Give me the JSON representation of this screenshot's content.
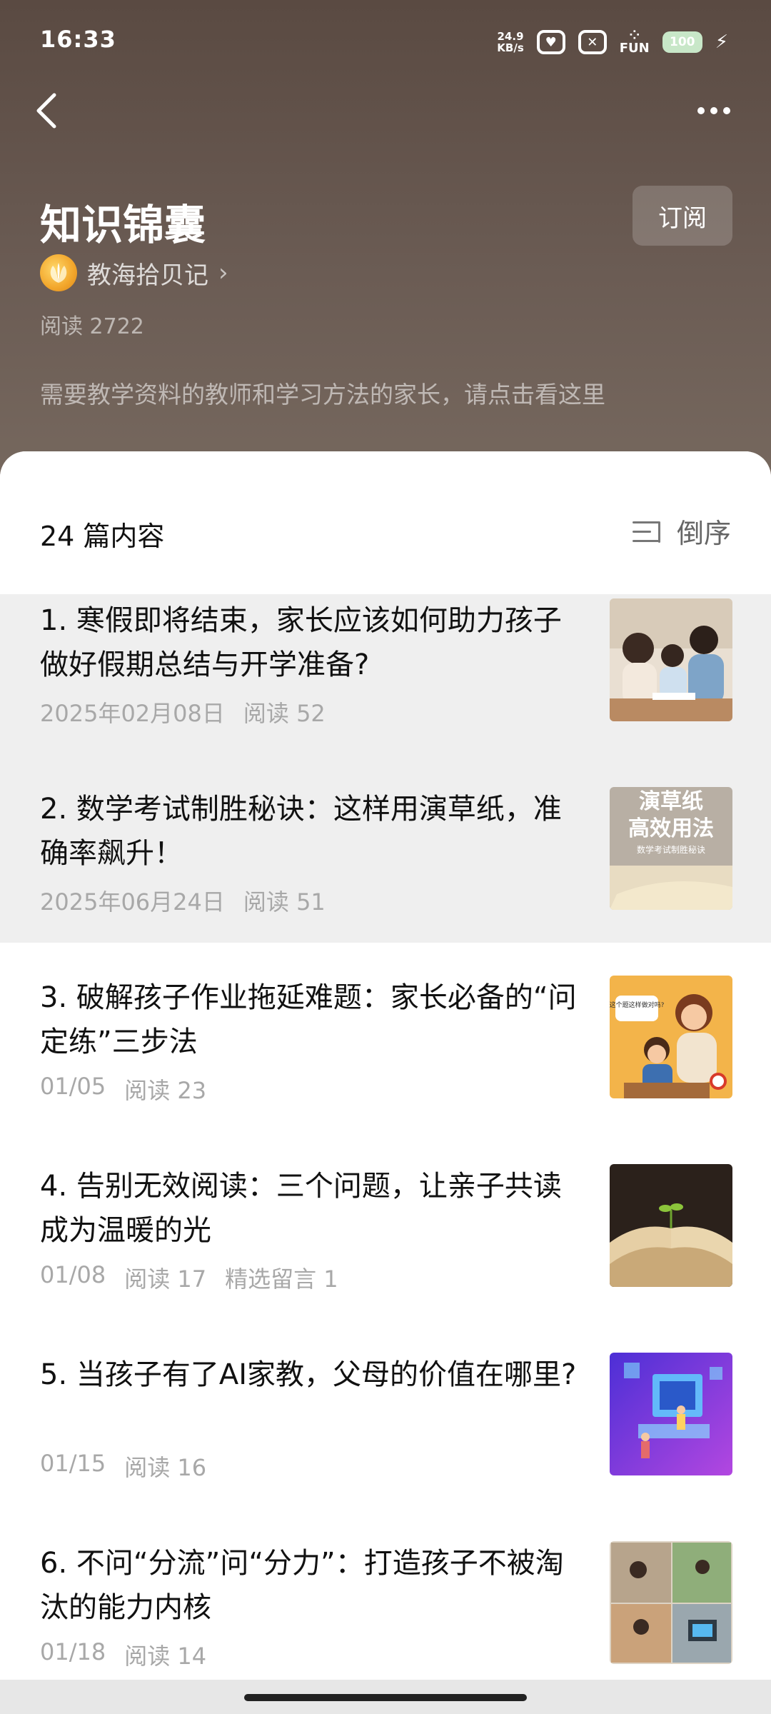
{
  "status": {
    "time": "16:33",
    "net_speed_value": "24.9",
    "net_speed_unit": "KB/s",
    "fun_label": "FUN",
    "battery": "100"
  },
  "collection": {
    "title": "知识锦囊",
    "subscribe_label": "订阅",
    "author": "教海拾贝记",
    "read_count": "阅读 2722",
    "description": "需要教学资料的教师和学习方法的家长，请点击看这里"
  },
  "list": {
    "count_label": "24 篇内容",
    "sort_label": "倒序",
    "items": [
      {
        "title": "1. 寒假即将结束，家长应该如何助力孩子做好假期总结与开学准备?",
        "date": "2025年02月08日",
        "reads": "阅读 52",
        "extra": "",
        "thumb": "family-study-photo"
      },
      {
        "title": "2. 数学考试制胜秘诀：这样用演草纸，准确率飙升！",
        "date": "2025年06月24日",
        "reads": "阅读 51",
        "extra": "",
        "thumb": "scratch-paper-cover",
        "thumb_text_1": "演草纸",
        "thumb_text_2": "高效用法",
        "thumb_text_3": "数学考试制胜秘诀"
      },
      {
        "title": "3. 破解孩子作业拖延难题：家长必备的“问定练”三步法",
        "date": "01/05",
        "reads": "阅读 23",
        "extra": "",
        "thumb": "homework-illustration",
        "thumb_text_1": "这个题这样做对吗?"
      },
      {
        "title": "4. 告别无效阅读：三个问题，让亲子共读成为温暖的光",
        "date": "01/08",
        "reads": "阅读 17",
        "extra": "精选留言 1",
        "thumb": "open-book-sprout"
      },
      {
        "title": "5. 当孩子有了AI家教，父母的价值在哪里?",
        "date": "01/15",
        "reads": "阅读 16",
        "extra": "",
        "thumb": "ai-tutor-illustration"
      },
      {
        "title": "6. 不问“分流”问“分力”：打造孩子不被淘汰的能力内核",
        "date": "01/18",
        "reads": "阅读 14",
        "extra": "",
        "thumb": "skills-collage"
      }
    ]
  }
}
